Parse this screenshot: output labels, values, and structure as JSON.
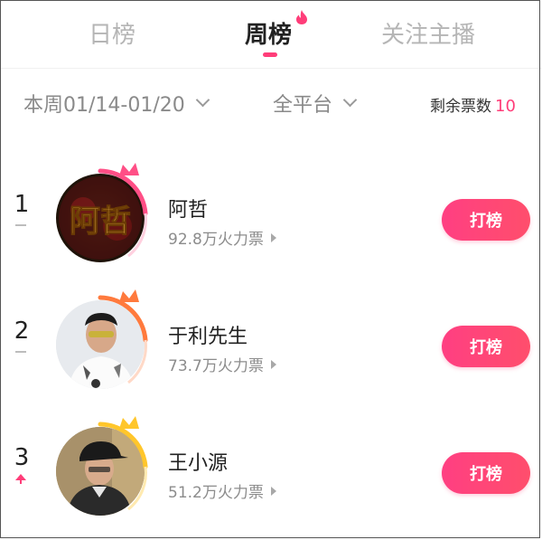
{
  "tabs": {
    "day": "日榜",
    "week": "周榜",
    "follow": "关注主播"
  },
  "filters": {
    "week_range": "本周01/14-01/20",
    "platform": "全平台"
  },
  "votes": {
    "label": "剩余票数",
    "count": "10"
  },
  "ranking": [
    {
      "rank": "1",
      "name": "阿哲",
      "fire": "92.8万火力票",
      "button": "打榜",
      "trend": "same",
      "avatar_text": "阿哲",
      "ring_color": "#ff4f86"
    },
    {
      "rank": "2",
      "name": "于利先生",
      "fire": "73.7万火力票",
      "button": "打榜",
      "trend": "same",
      "ring_color": "#ff7a3d"
    },
    {
      "rank": "3",
      "name": "王小源",
      "fire": "51.2万火力票",
      "button": "打榜",
      "trend": "up",
      "ring_color": "#ffc62b"
    }
  ],
  "colors": {
    "accent": "#ff3d79",
    "inactive_tab": "#b5b5b5"
  }
}
